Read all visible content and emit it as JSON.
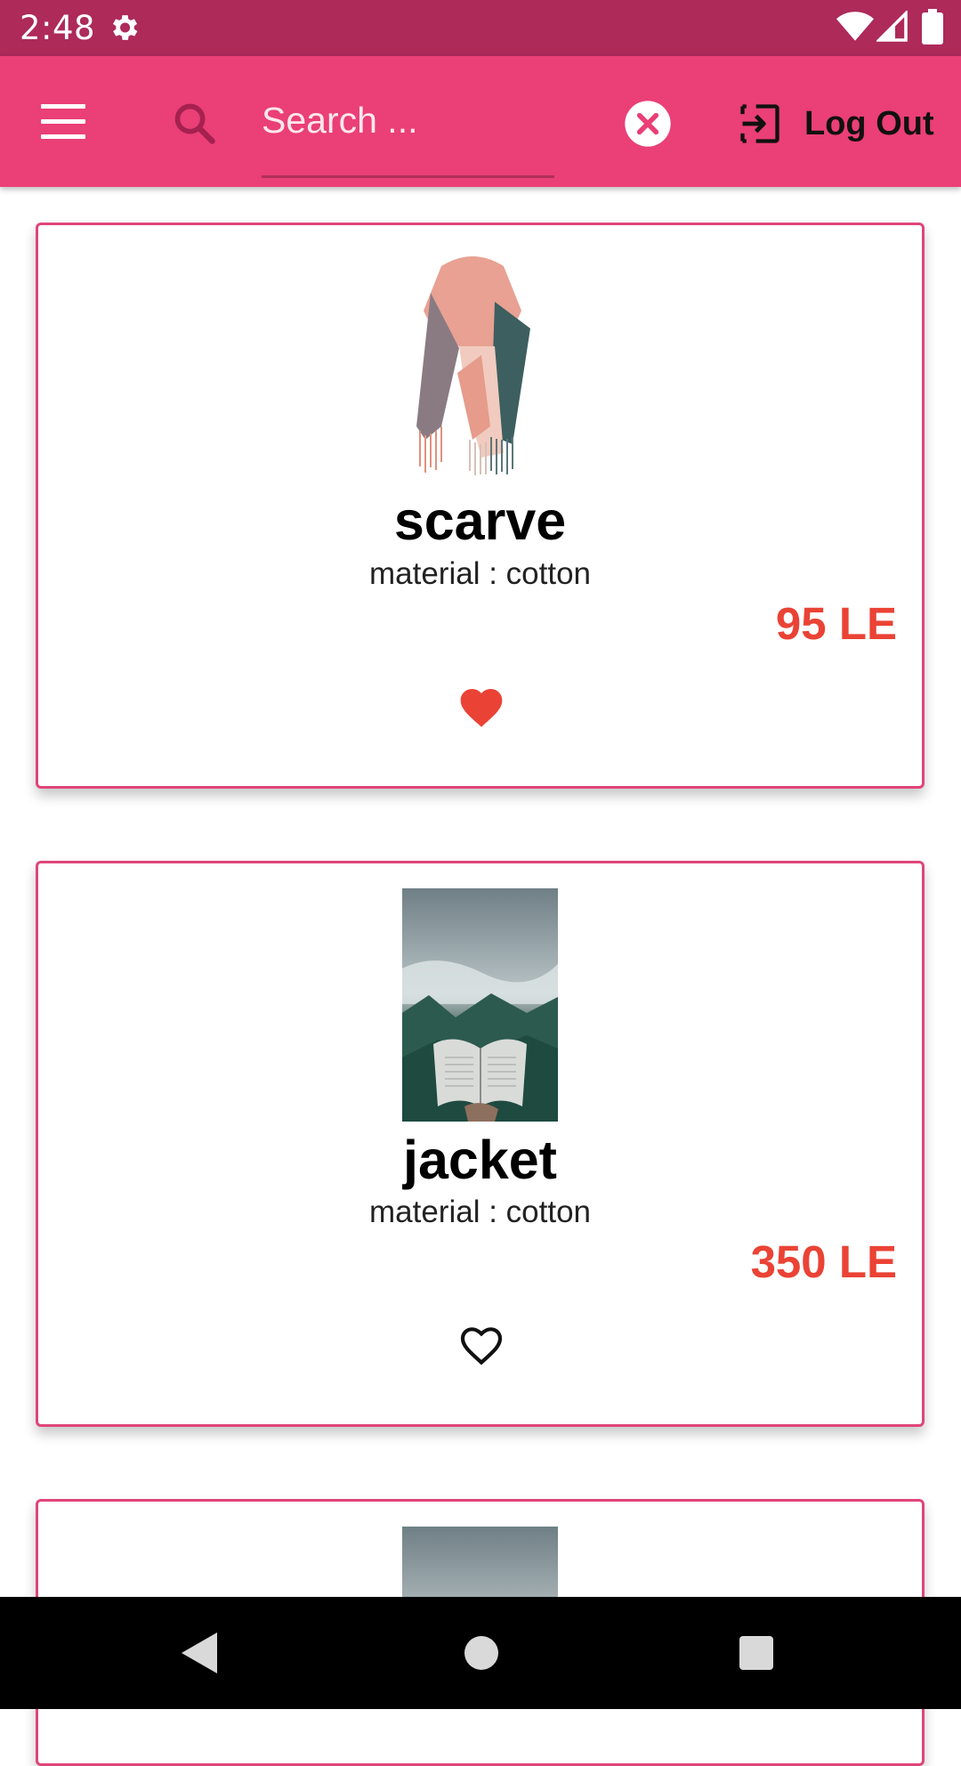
{
  "status_bar": {
    "time": "2:48",
    "icons": [
      "gear-icon",
      "wifi-icon",
      "signal-icon",
      "battery-icon"
    ]
  },
  "app_bar": {
    "menu_icon": "menu-icon",
    "search": {
      "icon": "search-icon",
      "placeholder": "Search ...",
      "value": ""
    },
    "clear_icon": "close-circle-icon",
    "logout": {
      "icon": "logout-icon",
      "label": "Log Out"
    },
    "color": "#ea3f77"
  },
  "products": [
    {
      "name": "scarve",
      "material": "material : cotton",
      "price": "95 LE",
      "favorite": true,
      "image": "scarf-photo"
    },
    {
      "name": "jacket",
      "material": "material : cotton",
      "price": "350 LE",
      "favorite": false,
      "image": "book-forest-photo"
    },
    {
      "image": "book-forest-photo"
    }
  ],
  "colors": {
    "accent": "#ea3f77",
    "price": "#ea4335",
    "status_bar": "#ad2a59"
  },
  "nav_bar": [
    "back-icon",
    "home-icon",
    "recents-icon"
  ]
}
